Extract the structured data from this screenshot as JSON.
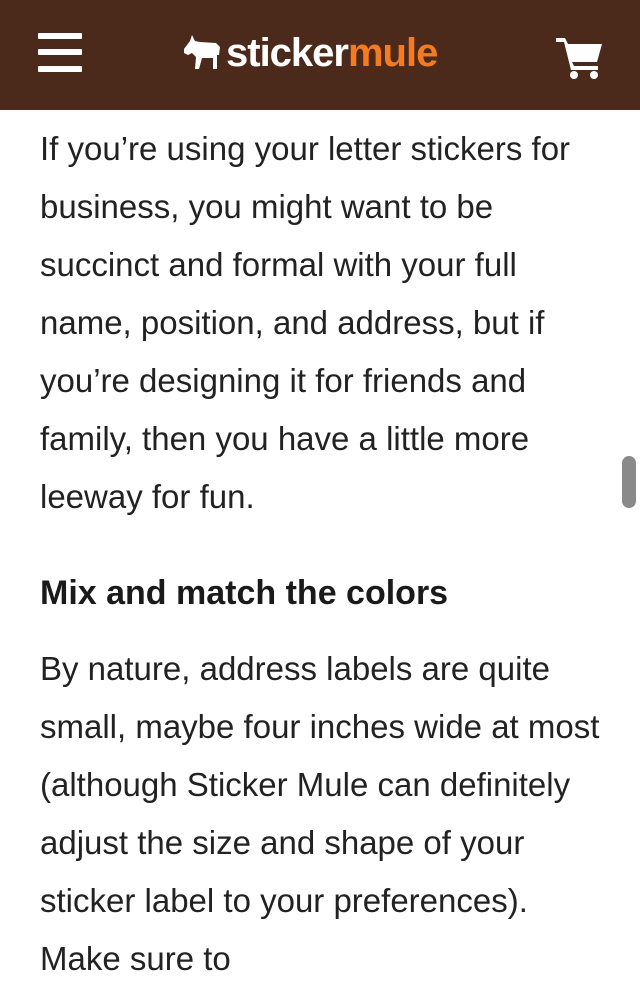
{
  "header": {
    "logo_word1": "sticker",
    "logo_word2": "mule",
    "brand_color": "#4b2a1c",
    "accent_color": "#f47b20",
    "menu_icon": "hamburger-icon",
    "cart_icon": "cart-icon"
  },
  "article": {
    "paragraph1": "If you’re using your letter stickers for business, you might want to be succinct and formal with your full name, position, and address, but if you’re designing it for friends and family, then you have a little more leeway for fun.",
    "heading": "Mix and match the colors",
    "paragraph2": "By nature, address labels are quite small, maybe four inches wide at most (although Sticker Mule can definitely adjust the size and shape of your sticker label to your preferences). Make sure to"
  }
}
